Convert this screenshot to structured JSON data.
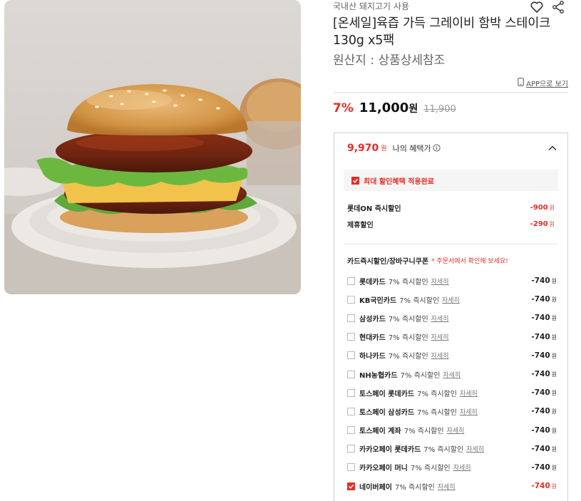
{
  "product": {
    "origin_tag": "국내산 돼지고기 사용",
    "title": "[온세일]육즙 가득 그레이비 함박 스테이크 130g x5팩",
    "origin_line": "원산지 : 상품상세참조",
    "app_view_label": "APP으로 보기",
    "image_icon": "burger-product-photo"
  },
  "icons": {
    "like": "heart-icon",
    "share": "share-icon",
    "app": "mobile-icon"
  },
  "price": {
    "discount_rate": "7%",
    "sale_price": "11,000",
    "currency": "원",
    "original_price": "11,900"
  },
  "benefit": {
    "price": "9,970",
    "unit": "원",
    "label": "나의 혜택가",
    "max_applied": "최대 할인혜택 적용완료",
    "discounts": [
      {
        "name": "롯데ON 즉시할인",
        "amount": "-900",
        "unit": "원"
      },
      {
        "name": "제휴할인",
        "amount": "-290",
        "unit": "원"
      }
    ],
    "card_header": "카드즉시할인/장바구니쿠폰",
    "card_note": "* 주문서에서 확인해 보세요!",
    "cards": [
      {
        "name": "롯데카드",
        "pct": "7% 즉시할인",
        "detail": "자세히",
        "amount": "-740",
        "unit": "원",
        "checked": false
      },
      {
        "name": "KB국민카드",
        "pct": "7% 즉시할인",
        "detail": "자세히",
        "amount": "-740",
        "unit": "원",
        "checked": false
      },
      {
        "name": "삼성카드",
        "pct": "7% 즉시할인",
        "detail": "자세히",
        "amount": "-740",
        "unit": "원",
        "checked": false
      },
      {
        "name": "현대카드",
        "pct": "7% 즉시할인",
        "detail": "자세히",
        "amount": "-740",
        "unit": "원",
        "checked": false
      },
      {
        "name": "하나카드",
        "pct": "7% 즉시할인",
        "detail": "자세히",
        "amount": "-740",
        "unit": "원",
        "checked": false
      },
      {
        "name": "NH농협카드",
        "pct": "7% 즉시할인",
        "detail": "자세히",
        "amount": "-740",
        "unit": "원",
        "checked": false
      },
      {
        "name": "토스페이 롯데카드",
        "pct": "7% 즉시할인",
        "detail": "자세히",
        "amount": "-740",
        "unit": "원",
        "checked": false
      },
      {
        "name": "토스페이 삼성카드",
        "pct": "7% 즉시할인",
        "detail": "자세히",
        "amount": "-740",
        "unit": "원",
        "checked": false
      },
      {
        "name": "토스페이 계좌",
        "pct": "7% 즉시할인",
        "detail": "자세히",
        "amount": "-740",
        "unit": "원",
        "checked": false
      },
      {
        "name": "카카오페이 롯데카드",
        "pct": "7% 즉시할인",
        "detail": "자세히",
        "amount": "-740",
        "unit": "원",
        "checked": false
      },
      {
        "name": "카카오페이 머니",
        "pct": "7% 즉시할인",
        "detail": "자세히",
        "amount": "-740",
        "unit": "원",
        "checked": false
      },
      {
        "name": "네이버페이",
        "pct": "7% 즉시할인",
        "detail": "자세히",
        "amount": "-740",
        "unit": "원",
        "checked": true
      }
    ]
  },
  "colors": {
    "accent": "#e52d27",
    "muted": "#999999",
    "border": "#cfcfcf"
  }
}
